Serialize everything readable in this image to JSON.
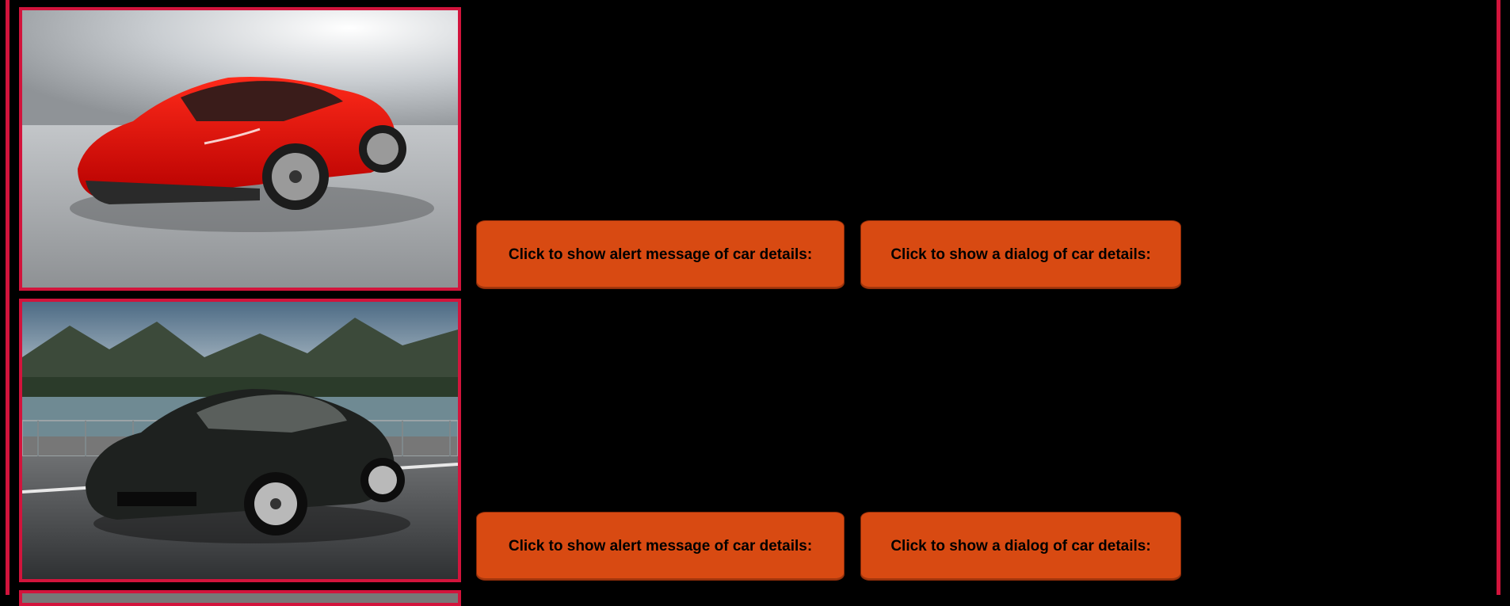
{
  "cars": [
    {
      "image": "red-sports-car",
      "alert_button_label": "Click to show alert message of car details:",
      "dialog_button_label": "Click to show a dialog of car details:"
    },
    {
      "image": "black-coupe-on-bridge",
      "alert_button_label": "Click to show alert message of car details:",
      "dialog_button_label": "Click to show a dialog of car details:"
    },
    {
      "image": "partially-visible-car"
    }
  ],
  "colors": {
    "frame_border": "#d2143c",
    "button_bg": "#d84a12",
    "page_bg": "#000000"
  }
}
